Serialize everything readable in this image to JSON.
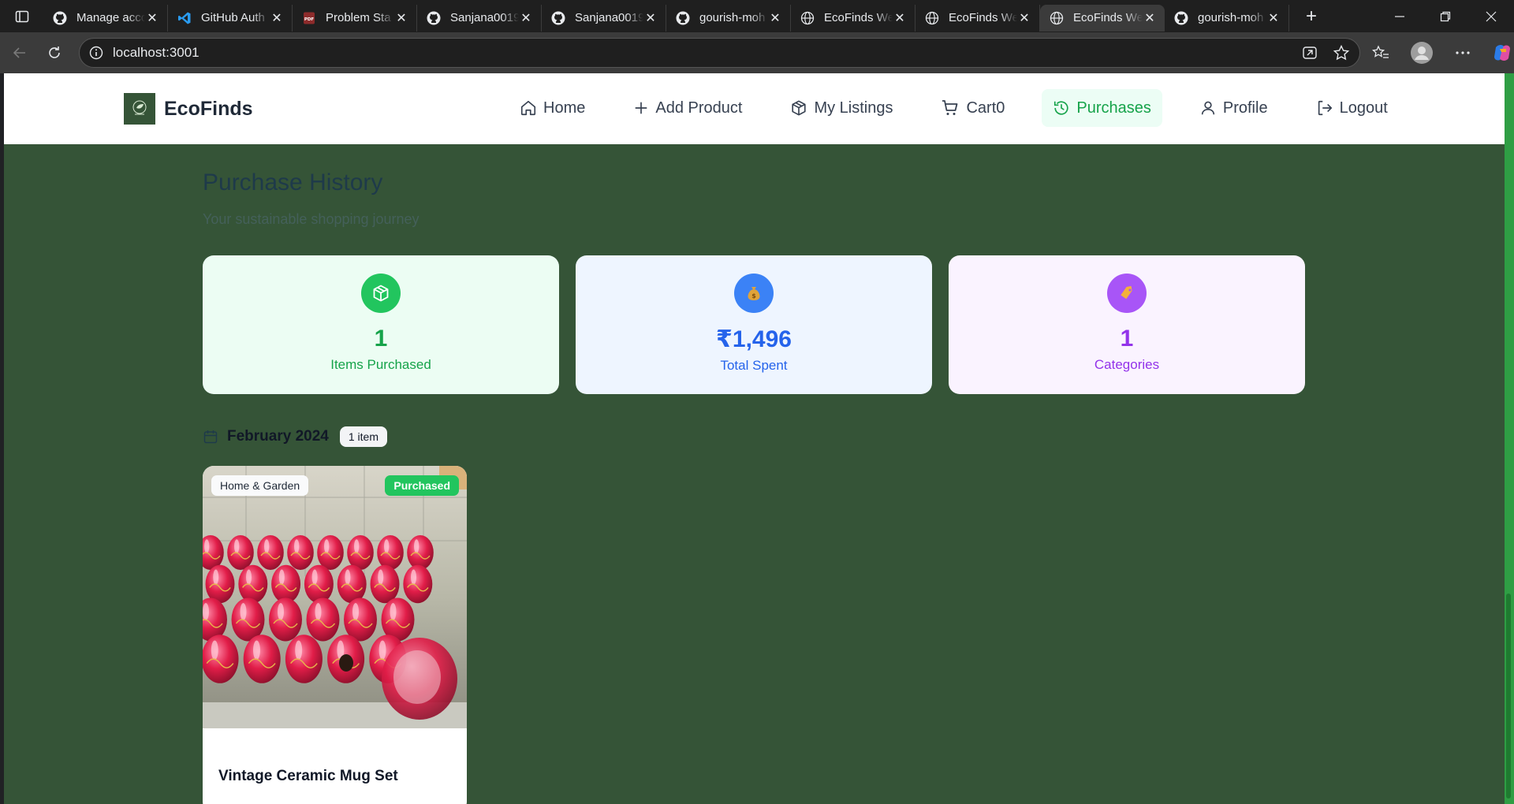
{
  "browser": {
    "tabs": [
      {
        "title": "Manage acco",
        "icon": "github-icon"
      },
      {
        "title": "GitHub Auth",
        "icon": "vscode-icon"
      },
      {
        "title": "Problem Sta",
        "icon": "pdf-icon"
      },
      {
        "title": "Sanjana0019",
        "icon": "github-icon"
      },
      {
        "title": "Sanjana0019",
        "icon": "github-icon"
      },
      {
        "title": "gourish-moh",
        "icon": "github-icon"
      },
      {
        "title": "EcoFinds We",
        "icon": "globe-icon"
      },
      {
        "title": "EcoFinds We",
        "icon": "globe-icon"
      },
      {
        "title": "EcoFinds We",
        "icon": "globe-icon",
        "active": true
      },
      {
        "title": "gourish-moh",
        "icon": "github-icon"
      }
    ],
    "url": "localhost:3001"
  },
  "app": {
    "logo_text": "EcoFinds",
    "nav": [
      {
        "label": "Home",
        "icon": "home-icon"
      },
      {
        "label": "Add Product",
        "icon": "plus-icon"
      },
      {
        "label": "My Listings",
        "icon": "box-icon"
      },
      {
        "label": "Cart0",
        "icon": "cart-icon"
      },
      {
        "label": "Purchases",
        "icon": "history-icon",
        "active": true
      },
      {
        "label": "Profile",
        "icon": "user-icon"
      },
      {
        "label": "Logout",
        "icon": "logout-icon"
      }
    ]
  },
  "main": {
    "title": "Purchase History",
    "subtitle": "Your sustainable shopping journey",
    "stats": [
      {
        "value": "1",
        "label": "Items Purchased",
        "icon": "box-icon",
        "bg": "#ecfdf3",
        "accent": "#16a34a",
        "circle": "#22c55e"
      },
      {
        "value": "₹1,496",
        "label": "Total Spent",
        "icon": "money-bag-icon",
        "bg": "#eef5ff",
        "accent": "#2563eb",
        "circle": "#3b82f6"
      },
      {
        "value": "1",
        "label": "Categories",
        "icon": "tag-icon",
        "bg": "#faf3ff",
        "accent": "#9333ea",
        "circle": "#a855f7"
      }
    ],
    "group": {
      "month": "February 2024",
      "count": "1 item"
    },
    "product": {
      "category": "Home & Garden",
      "status": "Purchased",
      "name": "Vintage Ceramic Mug Set"
    }
  }
}
